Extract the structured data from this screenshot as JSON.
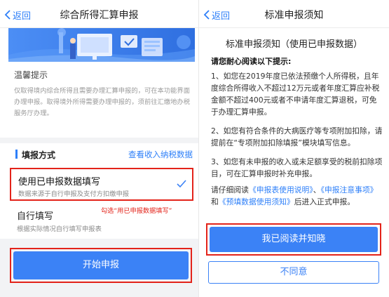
{
  "left_screen": {
    "back_label": "返回",
    "title": "综合所得汇算申报",
    "tips_title": "温馨提示",
    "tips_text": "仅取得境内综合所得且需要办理汇算申报的，可在本功能界面办理申报。取得境外所得需要办理申报的，须前往汇缴地办税服务厅办理。",
    "section_title": "填报方式",
    "section_link": "查看收入纳税数据",
    "option_prefill": {
      "title": "使用已申报数据填写",
      "desc": "数据来源于自行申报及支付方扣缴申报"
    },
    "annotation": "勾选“用已申报数据填写”",
    "option_manual": {
      "title": "自行填写",
      "desc": "根据实际情况自行填写申报表"
    },
    "start_button": "开始申报"
  },
  "right_screen": {
    "back_label": "返回",
    "title": "标准申报须知",
    "heading": "标准申报须知（使用已申报数据）",
    "prompt": "请您耐心阅读以下提示:",
    "para1": "1、如您在2019年度已依法预缴个人所得税，且年度综合所得收入不超过12万元或者年度汇算应补税金额不超过400元或者不申请年度汇算退税，可免于办理汇算申报。",
    "para2": "2、如您有符合条件的大病医疗等专项附加扣除，请提前在“专项附加扣除填报”模块填写信息。",
    "para3": "3、如您有未申报的收入或未足额享受的税前扣除项目，可在汇算申报时补充申报。",
    "para4": {
      "pre": "请仔细阅读",
      "link1": "《申报表使用说明》",
      "sep1": "、",
      "link2": "《申报注意事项》",
      "sep2": "和",
      "link3": "《预填数据使用须知》",
      "post": "后进入正式申报。"
    },
    "read_button": "我已阅读并知晓",
    "disagree_button": "不同意"
  },
  "colors": {
    "accent": "#3b82f6",
    "link": "#2d7ff9",
    "highlight_border": "#e3231a"
  },
  "icons": [
    "back-chevron-icon",
    "checkmark-icon",
    "banner-illustration"
  ]
}
